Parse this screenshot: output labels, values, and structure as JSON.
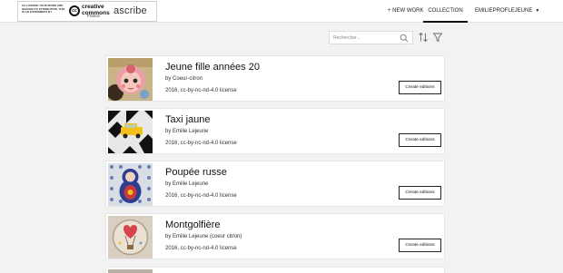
{
  "header": {
    "brand_small_text": "CC-LICENSE YOUR WORK AND SECURE ITS ATTRIBUTION. THIS IS AN EXPERIMENT BY",
    "cc_logo_text": "cc",
    "cc_name": "creative commons",
    "cc_country": "France",
    "brand_name": "ascribe",
    "nav": {
      "new_work": "+ NEW WORK",
      "collection": "COLLECTION",
      "user": "EMILIEPROFLEJEUNE"
    }
  },
  "toolbar": {
    "search_placeholder": "Rechercher...",
    "icons": [
      "search-icon",
      "sort-icon",
      "filter-icon"
    ]
  },
  "works": [
    {
      "title": "Jeune fille années 20",
      "author": "by Coeur-citron",
      "meta": "2016, cc-by-nc-nd-4.0 license",
      "button": "Create editions"
    },
    {
      "title": "Taxi jaune",
      "author": "by Emilie Lejeune",
      "meta": "2016, cc-by-nc-nd-4.0 license",
      "button": "Create editions"
    },
    {
      "title": "Poupée russe",
      "author": "by Emilie Lejeune",
      "meta": "2016, cc-by-nc-nd-4.0 license",
      "button": "Create editions"
    },
    {
      "title": "Montgolfière",
      "author": "by Emilie Lejeune (coeur citron)",
      "meta": "2016, cc-by-nc-nd-4.0 license",
      "button": "Create editions"
    }
  ]
}
